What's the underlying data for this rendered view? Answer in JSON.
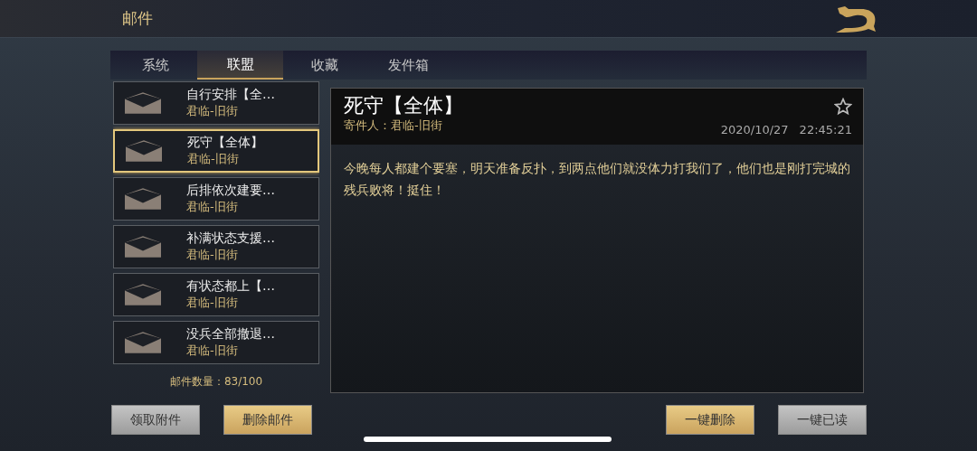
{
  "header": {
    "title": "邮件"
  },
  "tabs": [
    {
      "label": "系统",
      "selected": false
    },
    {
      "label": "联盟",
      "selected": true
    },
    {
      "label": "收藏",
      "selected": false
    },
    {
      "label": "发件箱",
      "selected": false
    }
  ],
  "mails": [
    {
      "subject": "自行安排【全…",
      "sender": "君临-旧街",
      "selected": false
    },
    {
      "subject": "死守【全体】",
      "sender": "君临-旧街",
      "selected": true
    },
    {
      "subject": "后排依次建要…",
      "sender": "君临-旧街",
      "selected": false
    },
    {
      "subject": "补满状态支援…",
      "sender": "君临-旧街",
      "selected": false
    },
    {
      "subject": "有状态都上【…",
      "sender": "君临-旧街",
      "selected": false
    },
    {
      "subject": "没兵全部撤退…",
      "sender": "君临-旧街",
      "selected": false
    }
  ],
  "mail_count": "邮件数量：83/100",
  "detail": {
    "title": "死守【全体】",
    "sender": "寄件人：君临-旧街",
    "date": "2020/10/27",
    "time": "22:45:21",
    "starred": false,
    "body": "今晚每人都建个要塞，明天准备反扑，到两点他们就没体力打我们了，他们也是刚打完城的残兵败将！挺住！"
  },
  "left_buttons": [
    {
      "label": "领取附件",
      "kind": "grey"
    },
    {
      "label": "删除邮件",
      "kind": "gold"
    }
  ],
  "right_buttons": [
    {
      "label": "一键删除",
      "kind": "gold"
    },
    {
      "label": "一键已读",
      "kind": "grey"
    }
  ]
}
